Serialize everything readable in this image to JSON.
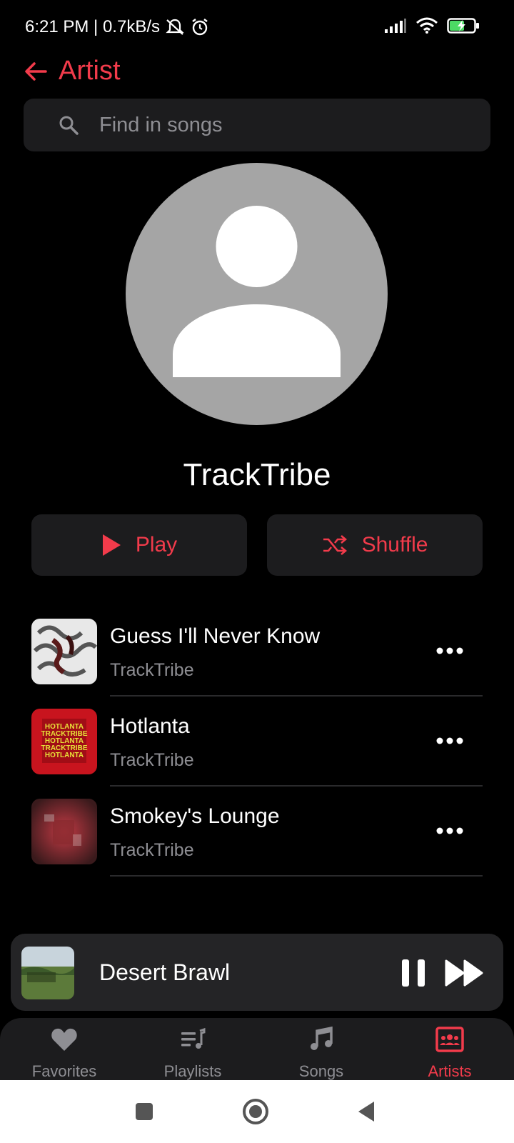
{
  "status_bar": {
    "time_text": "6:21 PM | 0.7kB/s",
    "icons": [
      "mute-icon",
      "alarm-icon",
      "signal-icon",
      "wifi-icon",
      "battery-icon"
    ]
  },
  "header": {
    "title": "Artist"
  },
  "search": {
    "placeholder": "Find in songs"
  },
  "artist": {
    "name": "TrackTribe"
  },
  "actions": {
    "play_label": "Play",
    "shuffle_label": "Shuffle"
  },
  "songs": [
    {
      "title": "Guess I'll Never Know",
      "artist": "TrackTribe"
    },
    {
      "title": "Hotlanta",
      "artist": "TrackTribe",
      "art_text": [
        "HOTLANTA",
        "TRACKTRIBE",
        "HOTLANTA",
        "TRACKTRIBE",
        "HOTLANTA"
      ]
    },
    {
      "title": "Smokey's Lounge",
      "artist": "TrackTribe"
    }
  ],
  "mini_player": {
    "title": "Desert Brawl"
  },
  "tabs": [
    {
      "label": "Favorites",
      "icon": "heart-icon"
    },
    {
      "label": "Playlists",
      "icon": "playlist-icon"
    },
    {
      "label": "Songs",
      "icon": "music-note-icon"
    },
    {
      "label": "Artists",
      "icon": "artists-icon",
      "active": true
    }
  ],
  "colors": {
    "accent": "#f23b4b",
    "background": "#000000",
    "surface": "#1c1c1e",
    "secondary_text": "#8e8e93"
  }
}
